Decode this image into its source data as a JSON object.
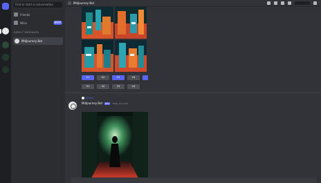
{
  "colors": {
    "blurple": "#5865f2",
    "link": "#00a8fc",
    "chat_bg": "#313338",
    "sidebar_bg": "#2b2d31",
    "rail_bg": "#1e1f22"
  },
  "sidebar": {
    "search_placeholder": "Find or start a conversation",
    "items": [
      {
        "label": "Friends",
        "icon": "friends-icon"
      },
      {
        "label": "Nitro",
        "icon": "nitro-icon",
        "badge": "NEW"
      }
    ],
    "section_header": "DIRECT MESSAGES",
    "dm": {
      "label": "Midjourney Bot"
    }
  },
  "topbar": {
    "channel": "Midjourney Bot"
  },
  "upscale_buttons": [
    "U1",
    "U2",
    "U3",
    "U4"
  ],
  "variation_buttons": [
    "V1",
    "V2",
    "V3",
    "V4"
  ],
  "message": {
    "reply_user": "@user",
    "author": "Midjourney Bot",
    "bot_tag": "BOT",
    "time": "Today at 12:00",
    "text_prefix": "",
    "text_link": "",
    "text_suffix": ""
  }
}
